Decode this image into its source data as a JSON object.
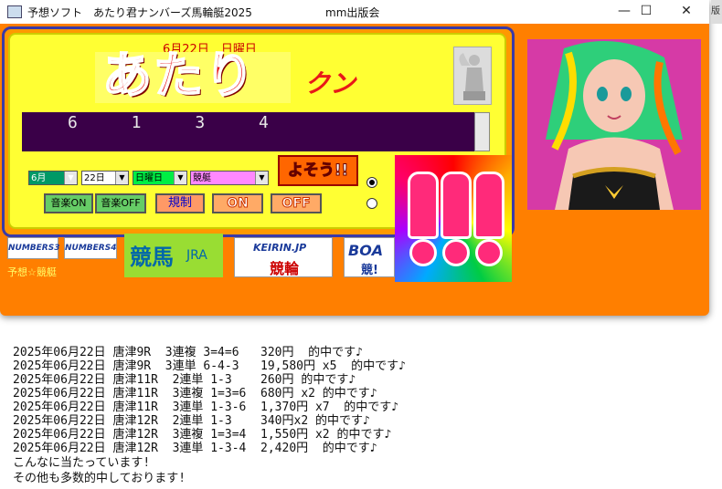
{
  "window": {
    "title": "予想ソフト　あたり君ナンバーズ馬輪艇2025",
    "center_title": "mm出版会",
    "minimize_icon": "minimize-icon",
    "maximize_icon": "maximize-icon",
    "close_icon": "close-icon"
  },
  "bg_edge_text": "版会",
  "header": {
    "date_line": "6月22日　日曜日",
    "logo_main": "あたり",
    "logo_sub": "クン"
  },
  "display": {
    "numbers": "6 1 3 4"
  },
  "controls": {
    "month": "6月",
    "day": "22日",
    "weekday": "日曜日",
    "category": "競艇",
    "predict_button": "よそう!!",
    "music_on": "音楽ON",
    "music_off": "音楽OFF",
    "rules_button": "規制",
    "on_button": "ON",
    "off_button": "OFF"
  },
  "banners": {
    "numbers3": "NUMBERS3",
    "numbers4": "NUMBERS4",
    "keiba": "競馬",
    "jra": "JRA",
    "keirin_top": "KEIRIN.JP",
    "keirin_bottom": "競輪",
    "boat": "BOA",
    "boat_sub": "競!"
  },
  "footer_link": "予想☆競艇",
  "results": [
    "2025年06月22日 唐津9R  3連複 3=4=6   320円  的中です♪",
    "2025年06月22日 唐津9R  3連単 6-4-3   19,580円 x5  的中です♪",
    "2025年06月22日 唐津11R  2連単 1-3    260円 的中です♪",
    "2025年06月22日 唐津11R  3連複 1=3=6  680円 x2 的中です♪",
    "2025年06月22日 唐津11R  3連単 1-3-6  1,370円 x7  的中です♪",
    "2025年06月22日 唐津12R  2連単 1-3    340円x2 的中です♪",
    "2025年06月22日 唐津12R  3連複 1=3=4  1,550円 x2 的中です♪",
    "2025年06月22日 唐津12R  3連単 1-3-4  2,420円  的中です♪"
  ],
  "message": {
    "line1": "こんなに当たっています!",
    "line2": "その他も多数的中しております!"
  },
  "colors": {
    "window_bg": "#ff7f00",
    "panel_bg": "#ffff33",
    "display_bg": "#3a0048",
    "logo_red": "#e81818"
  }
}
